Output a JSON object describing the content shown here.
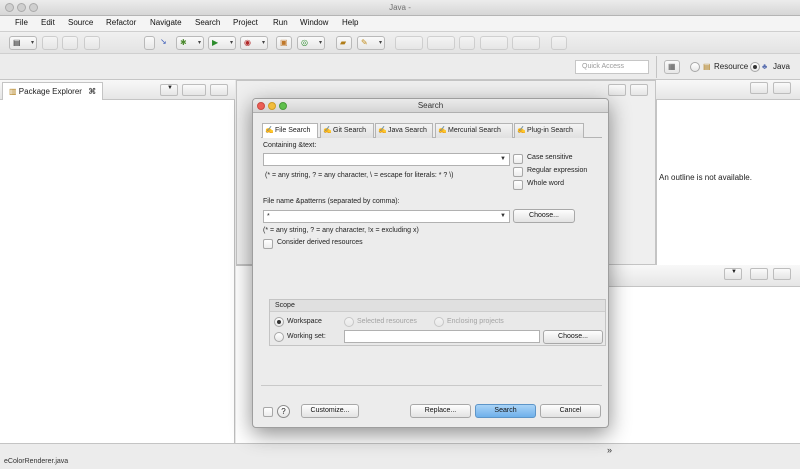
{
  "window": {
    "title": "Java -"
  },
  "menu": [
    "File",
    "Edit",
    "Source",
    "Refactor",
    "Navigate",
    "Search",
    "Project",
    "Run",
    "Window",
    "Help"
  ],
  "toolbar2": {
    "quick_access_placeholder": "Quick Access",
    "resource_label": "Resource",
    "java_label": "Java"
  },
  "left_view": {
    "tab_label": "Package Explorer",
    "tab_close": "⌘"
  },
  "outline": {
    "message": "An outline is not available."
  },
  "status": {
    "bottom_left_partial": "eColorRenderer.java",
    "bottom_right_glyph": "»"
  },
  "dialog": {
    "title": "Search",
    "tabs": [
      "File Search",
      "Git Search",
      "Java Search",
      "Mercurial Search",
      "Plug-in Search"
    ],
    "active_tab": 0,
    "containing_label": "Containing &text:",
    "containing_value": "",
    "hint1": "(* = any string, ? = any character, \\ = escape for literals: * ? \\)",
    "case_sensitive": "Case sensitive",
    "regular_expression": "Regular expression",
    "whole_word": "Whole word",
    "patterns_label": "File name &patterns (separated by comma):",
    "patterns_value": "*",
    "choose_label": "Choose...",
    "hint2": "(* = any string, ? = any character, !x = excluding x)",
    "derived": "Consider derived resources",
    "scope_title": "Scope",
    "workspace": "Workspace",
    "selected_resources": "Selected resources",
    "enclosing_projects": "Enclosing projects",
    "working_set": "Working set:",
    "working_set_value": "",
    "working_set_choose": "Choose...",
    "help_glyph": "?",
    "customize": "Customize...",
    "replace": "Replace...",
    "search": "Search",
    "cancel": "Cancel"
  },
  "colors": {
    "primary_button": "#6fb0ea",
    "traffic_red": "#ec5f56",
    "traffic_yellow": "#f2bd3c",
    "traffic_green": "#5fc04c"
  }
}
